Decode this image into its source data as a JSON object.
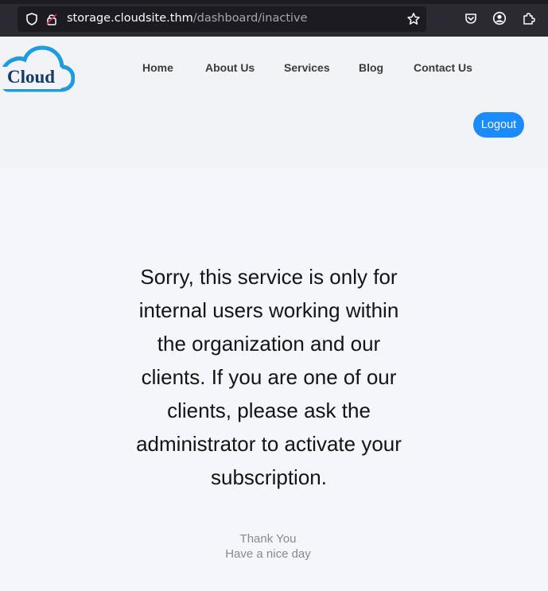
{
  "browser": {
    "url_host": "storage.cloudsite.thm",
    "url_path": "/dashboard/inactive",
    "icons": [
      "shield-icon",
      "lock-icon",
      "star-icon",
      "pocket-icon",
      "account-icon",
      "extensions-icon"
    ]
  },
  "header": {
    "logo_text": "Cloud",
    "nav": [
      "Home",
      "About Us",
      "Services",
      "Blog",
      "Contact Us"
    ],
    "logout_label": "Logout"
  },
  "main": {
    "message": "Sorry, this service is only for internal users working within the organization and our clients. If you are one of our clients, please ask the administrator to activate your subscription.",
    "thanks_line1": "Thank You",
    "thanks_line2": "Have a nice day"
  },
  "colors": {
    "accent": "#1a8cff",
    "logo_blue": "#1f9be0",
    "logo_navy": "#123a6b",
    "header_bg": "#f2f3f7",
    "browser_bg": "#2b2a33"
  }
}
